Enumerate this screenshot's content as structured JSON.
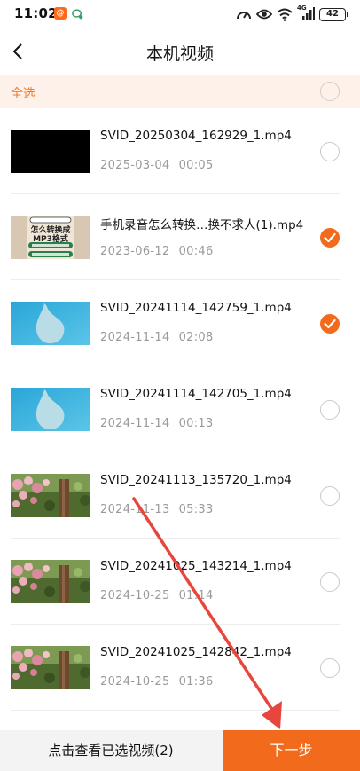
{
  "status_bar": {
    "time": "11:02",
    "app_badge": "@",
    "network_label": "4G",
    "battery": "42"
  },
  "header": {
    "title": "本机视频"
  },
  "select_all": {
    "label": "全选",
    "checked": false
  },
  "videos": [
    {
      "name": "SVID_20250304_162929_1.mp4",
      "date": "2025-03-04",
      "duration": "00:05",
      "checked": false,
      "thumb": "black"
    },
    {
      "name": "手机录音怎么转换…换不求人(1).mp4",
      "date": "2023-06-12",
      "duration": "00:46",
      "checked": true,
      "thumb": "tutorial"
    },
    {
      "name": "SVID_20241114_142759_1.mp4",
      "date": "2024-11-14",
      "duration": "02:08",
      "checked": true,
      "thumb": "blue-drop"
    },
    {
      "name": "SVID_20241114_142705_1.mp4",
      "date": "2024-11-14",
      "duration": "00:13",
      "checked": false,
      "thumb": "blue-drop"
    },
    {
      "name": "SVID_20241113_135720_1.mp4",
      "date": "2024-11-13",
      "duration": "05:33",
      "checked": false,
      "thumb": "flowers"
    },
    {
      "name": "SVID_20241025_143214_1.mp4",
      "date": "2024-10-25",
      "duration": "01:14",
      "checked": false,
      "thumb": "flowers"
    },
    {
      "name": "SVID_20241025_142842_1.mp4",
      "date": "2024-10-25",
      "duration": "01:36",
      "checked": false,
      "thumb": "flowers"
    }
  ],
  "thumb_text": {
    "line1": "怎么转换成",
    "line2": "MP3格式"
  },
  "bottom_bar": {
    "view_selected_label": "点击查看已选视频(2)",
    "next_label": "下一步"
  },
  "colors": {
    "accent": "#f26b1d",
    "select_all_bg": "#fdf1e9",
    "annotation_arrow": "#e8453c"
  },
  "icons": {
    "back": "chevron-left-icon",
    "check": "check-icon"
  }
}
